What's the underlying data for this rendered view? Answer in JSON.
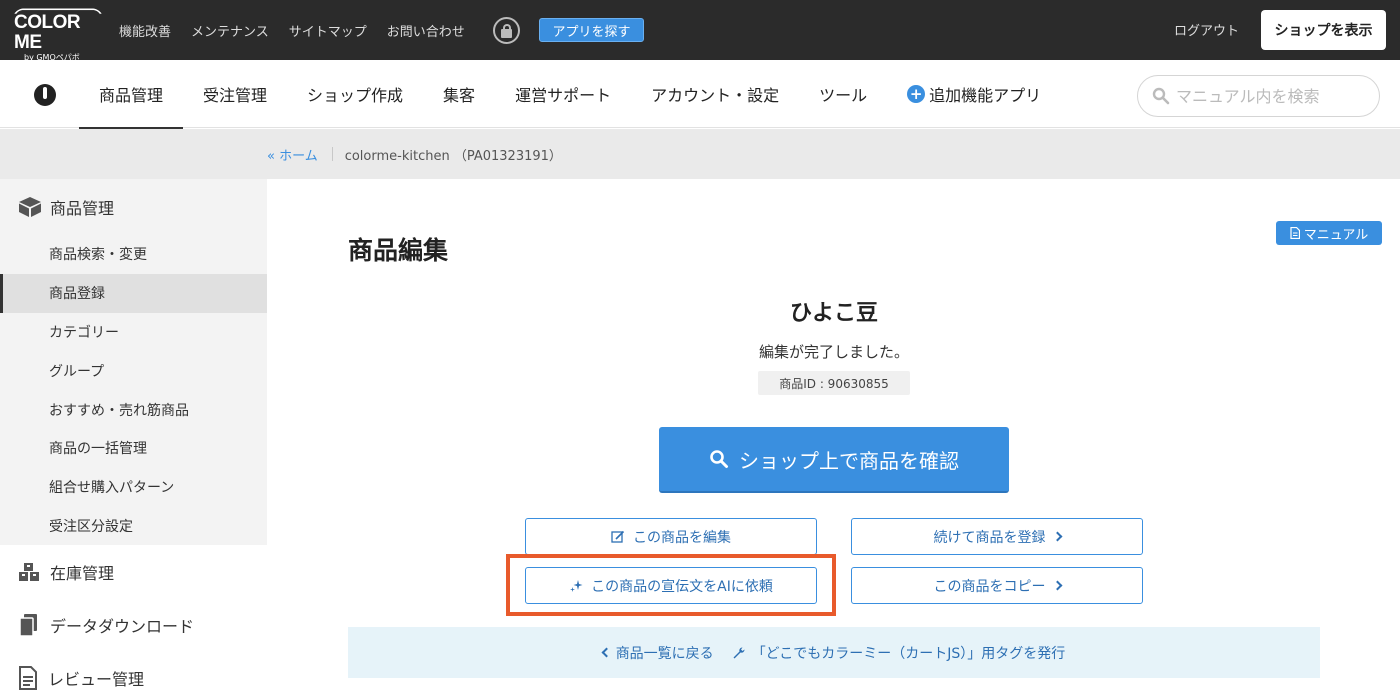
{
  "topbar": {
    "logo_main": "COLOR ME",
    "logo_sub": "by GMOペパボ",
    "links": [
      "機能改善",
      "メンテナンス",
      "サイトマップ",
      "お問い合わせ"
    ],
    "app_button": "アプリを探す",
    "logout": "ログアウト",
    "show_shop": "ショップを表示"
  },
  "mainnav": {
    "items": [
      "商品管理",
      "受注管理",
      "ショップ作成",
      "集客",
      "運営サポート",
      "アカウント・設定",
      "ツール"
    ],
    "add_app": "追加機能アプリ",
    "search_placeholder": "マニュアル内を検索"
  },
  "breadcrumb": {
    "home": "« ホーム",
    "shop": "colorme-kitchen （PA01323191）"
  },
  "sidebar": {
    "section": "商品管理",
    "items": [
      "商品検索・変更",
      "商品登録",
      "カテゴリー",
      "グループ",
      "おすすめ・売れ筋商品",
      "商品の一括管理",
      "組合せ購入パターン",
      "受注区分設定"
    ],
    "active_index": 1,
    "sections": [
      "在庫管理",
      "データダウンロード",
      "レビュー管理"
    ]
  },
  "content": {
    "title": "商品編集",
    "manual": "マニュアル",
    "product_name": "ひよこ豆",
    "done_msg": "編集が完了しました。",
    "product_id": "商品ID : 90630855",
    "view_button": "ショップ上で商品を確認",
    "edit_button": "この商品を編集",
    "register_button": "続けて商品を登録",
    "ai_button": "この商品の宣伝文をAIに依頼",
    "copy_button": "この商品をコピー",
    "back_link": "商品一覧に戻る",
    "tag_link": "「どこでもカラーミー（カートJS）」用タグを発行"
  },
  "colors": {
    "accent": "#3a8fdf",
    "highlight": "#e85a2b",
    "topbar": "#2b2b2b"
  }
}
